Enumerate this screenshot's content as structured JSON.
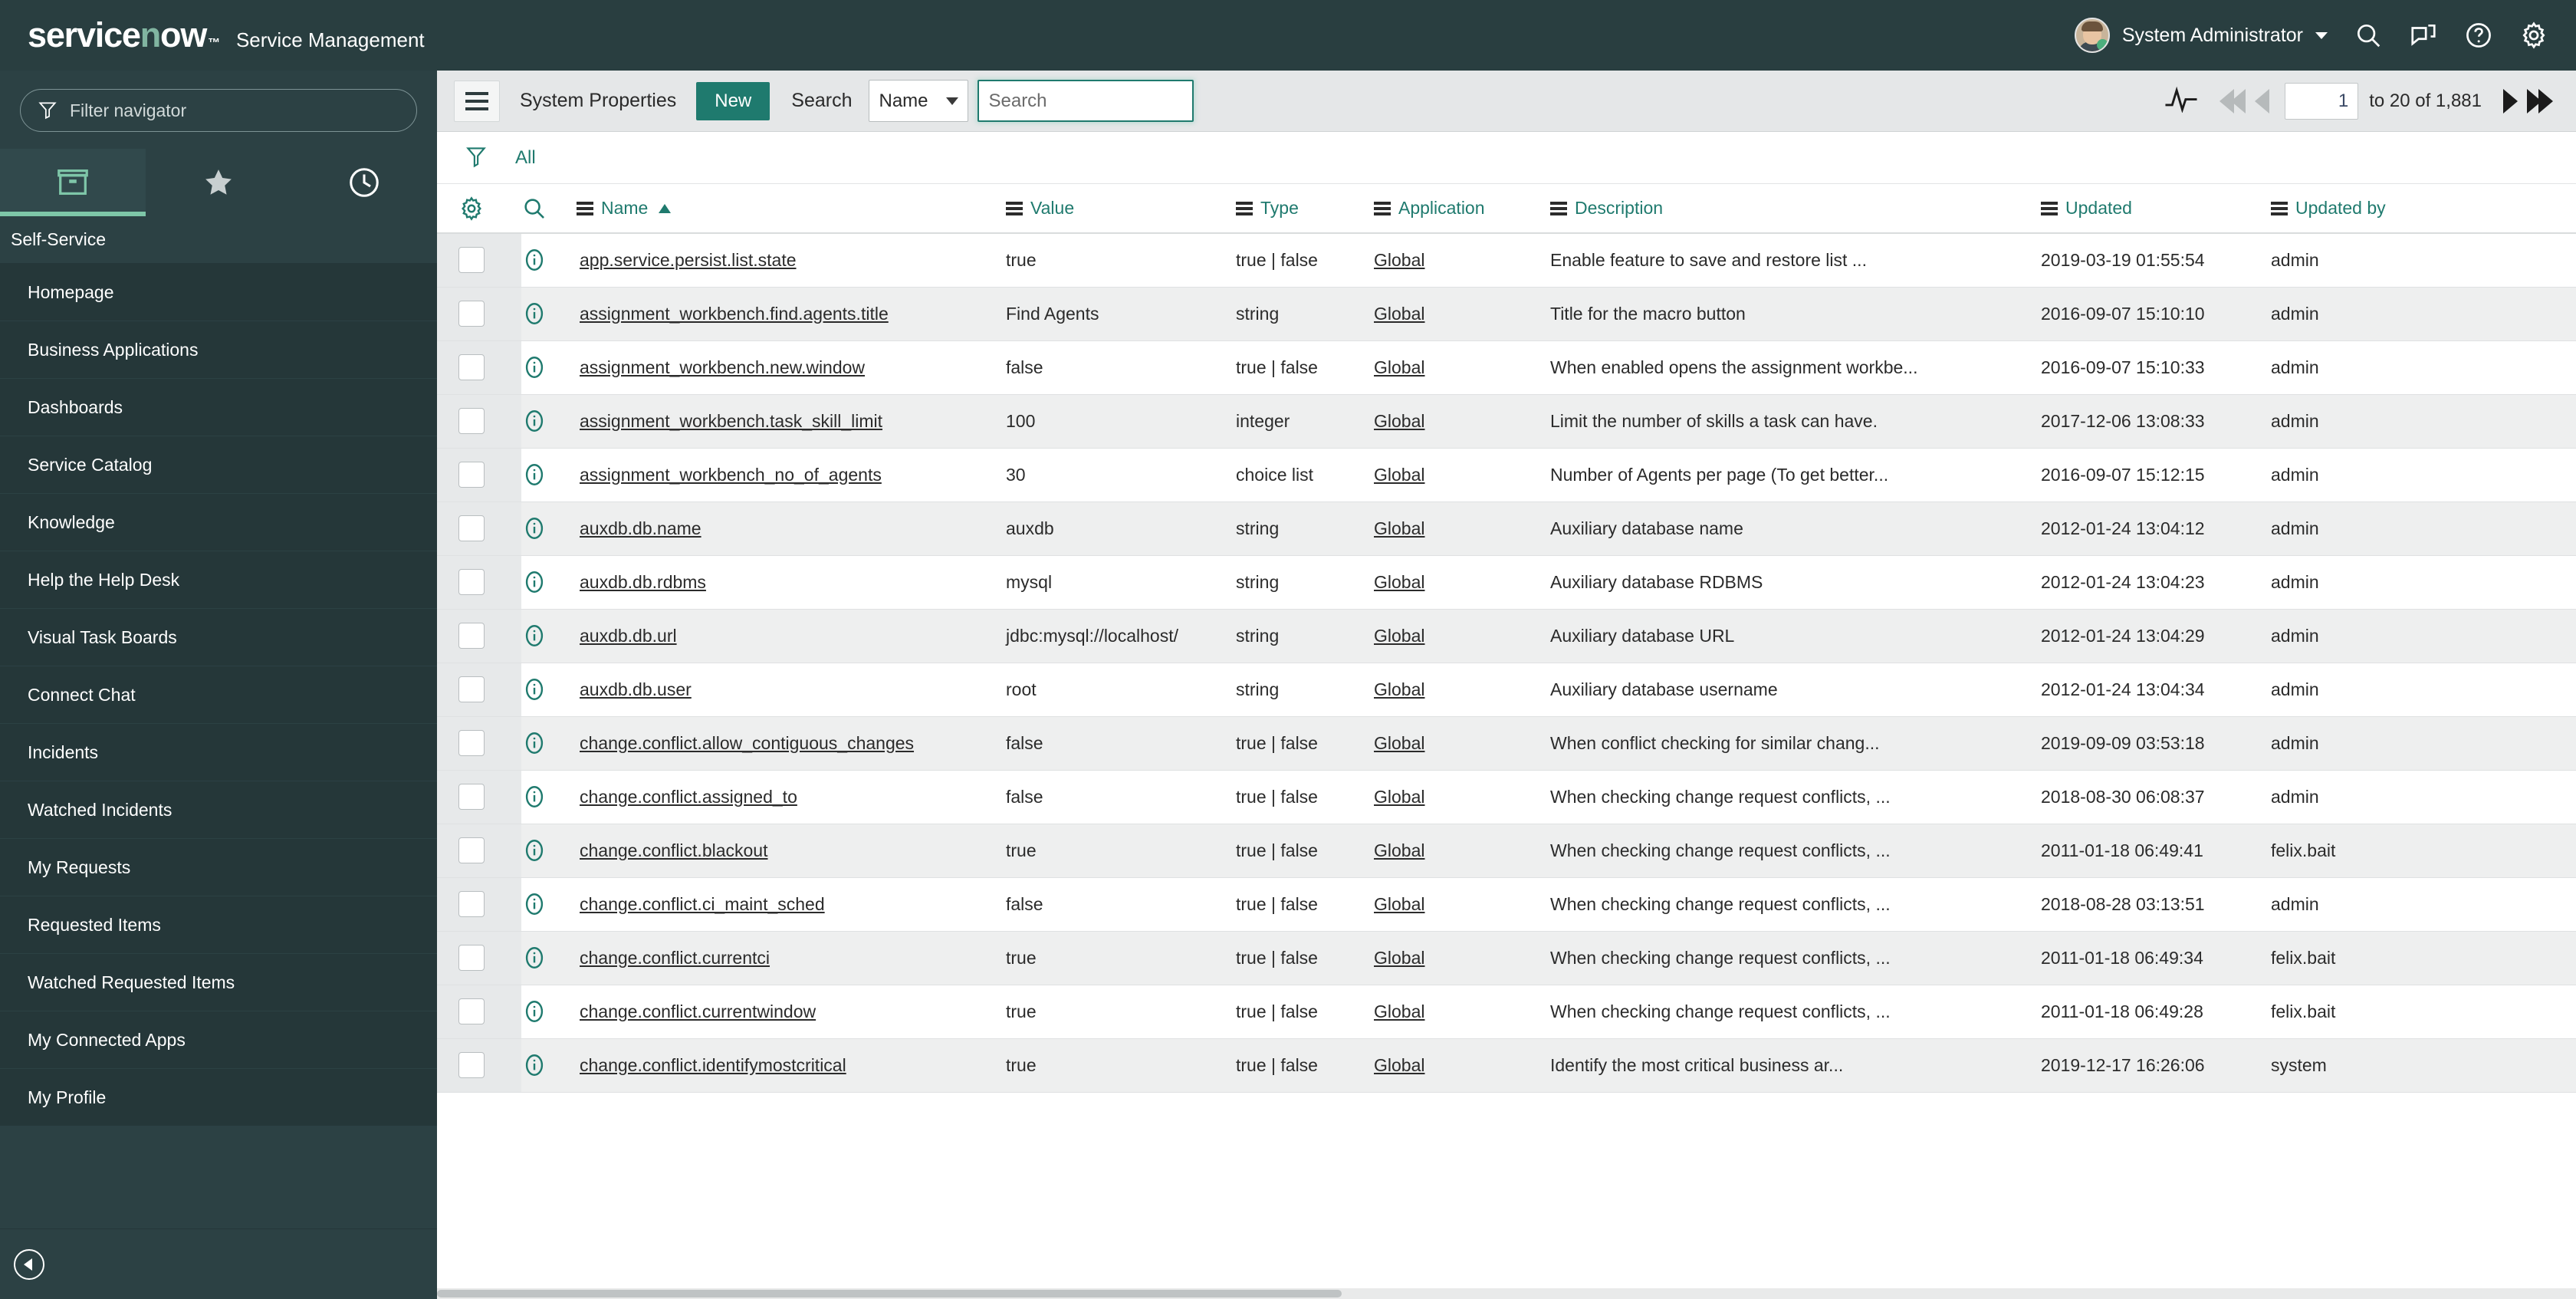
{
  "banner": {
    "logo_part1": "service",
    "logo_letter_o": "n",
    "logo_part3": "w",
    "logo_full": "servicenow",
    "product_name": "Service Management",
    "user_name": "System Administrator",
    "icons": [
      "search-icon",
      "conversations-icon",
      "help-icon",
      "gear-icon"
    ],
    "brand_color": "#293e40",
    "accent_color": "#81b5a1"
  },
  "sidebar": {
    "filter_placeholder": "Filter navigator",
    "filter_value": "",
    "tabs": [
      {
        "name": "all-applications-tab",
        "icon": "box-icon",
        "active": true
      },
      {
        "name": "favorites-tab",
        "icon": "star-icon",
        "active": false
      },
      {
        "name": "history-tab",
        "icon": "clock-icon",
        "active": false
      }
    ],
    "section_label": "Self-Service",
    "items": [
      {
        "label": "Homepage"
      },
      {
        "label": "Business Applications"
      },
      {
        "label": "Dashboards"
      },
      {
        "label": "Service Catalog"
      },
      {
        "label": "Knowledge"
      },
      {
        "label": "Help the Help Desk"
      },
      {
        "label": "Visual Task Boards"
      },
      {
        "label": "Connect Chat"
      },
      {
        "label": "Incidents"
      },
      {
        "label": "Watched Incidents"
      },
      {
        "label": "My Requests"
      },
      {
        "label": "Requested Items"
      },
      {
        "label": "Watched Requested Items"
      },
      {
        "label": "My Connected Apps"
      },
      {
        "label": "My Profile"
      }
    ],
    "collapse_icon": "collapse-left-icon"
  },
  "toolbar": {
    "menu_icon": "hamburger-menu-icon",
    "title": "System Properties",
    "new_label": "New",
    "search_label": "Search",
    "search_field_selected": "Name",
    "search_field_options": [
      "Name"
    ],
    "search_placeholder": "Search",
    "search_value": "",
    "pulse_icon": "activity-pulse-icon",
    "pagination": {
      "first_icon": "first-page-icon",
      "prev_icon": "previous-page-icon",
      "page_value": "1",
      "range_text": "to 20 of 1,881",
      "next_icon": "next-page-icon",
      "last_icon": "last-page-icon"
    }
  },
  "filter_bar": {
    "funnel_icon": "filter-funnel-icon",
    "all_label": "All"
  },
  "table": {
    "personalize_icon": "gear-icon",
    "search_row_icon": "magnifier-icon",
    "sort_column": "Name",
    "sort_direction": "asc",
    "columns": [
      {
        "key": "name",
        "label": "Name"
      },
      {
        "key": "value",
        "label": "Value"
      },
      {
        "key": "type",
        "label": "Type"
      },
      {
        "key": "application",
        "label": "Application"
      },
      {
        "key": "description",
        "label": "Description"
      },
      {
        "key": "updated",
        "label": "Updated"
      },
      {
        "key": "updated_by",
        "label": "Updated by"
      }
    ],
    "rows": [
      {
        "name": "app.service.persist.list.state",
        "value": "true",
        "type": "true | false",
        "application": "Global",
        "description": "Enable feature to save and restore list ...",
        "updated": "2019-03-19 01:55:54",
        "updated_by": "admin"
      },
      {
        "name": "assignment_workbench.find.agents.title",
        "value": "Find Agents",
        "type": "string",
        "application": "Global",
        "description": "Title for the macro button",
        "updated": "2016-09-07 15:10:10",
        "updated_by": "admin"
      },
      {
        "name": "assignment_workbench.new.window",
        "value": "false",
        "type": "true | false",
        "application": "Global",
        "description": "When enabled opens the assignment workbe...",
        "updated": "2016-09-07 15:10:33",
        "updated_by": "admin"
      },
      {
        "name": "assignment_workbench.task_skill_limit",
        "value": "100",
        "type": "integer",
        "application": "Global",
        "description": "Limit the number of skills a task can have.",
        "updated": "2017-12-06 13:08:33",
        "updated_by": "admin"
      },
      {
        "name": "assignment_workbench_no_of_agents",
        "value": "30",
        "type": "choice list",
        "application": "Global",
        "description": "Number of Agents per page (To get better...",
        "updated": "2016-09-07 15:12:15",
        "updated_by": "admin"
      },
      {
        "name": "auxdb.db.name",
        "value": "auxdb",
        "type": "string",
        "application": "Global",
        "description": "Auxiliary database name",
        "updated": "2012-01-24 13:04:12",
        "updated_by": "admin"
      },
      {
        "name": "auxdb.db.rdbms",
        "value": "mysql",
        "type": "string",
        "application": "Global",
        "description": "Auxiliary database RDBMS",
        "updated": "2012-01-24 13:04:23",
        "updated_by": "admin"
      },
      {
        "name": "auxdb.db.url",
        "value": "jdbc:mysql://localhost/",
        "type": "string",
        "application": "Global",
        "description": "Auxiliary database URL",
        "updated": "2012-01-24 13:04:29",
        "updated_by": "admin"
      },
      {
        "name": "auxdb.db.user",
        "value": "root",
        "type": "string",
        "application": "Global",
        "description": "Auxiliary database username",
        "updated": "2012-01-24 13:04:34",
        "updated_by": "admin"
      },
      {
        "name": "change.conflict.allow_contiguous_changes",
        "value": "false",
        "type": "true | false",
        "application": "Global",
        "description": "When conflict checking for similar chang...",
        "updated": "2019-09-09 03:53:18",
        "updated_by": "admin"
      },
      {
        "name": "change.conflict.assigned_to",
        "value": "false",
        "type": "true | false",
        "application": "Global",
        "description": "When checking change request conflicts, ...",
        "updated": "2018-08-30 06:08:37",
        "updated_by": "admin"
      },
      {
        "name": "change.conflict.blackout",
        "value": "true",
        "type": "true | false",
        "application": "Global",
        "description": "When checking change request conflicts, ...",
        "updated": "2011-01-18 06:49:41",
        "updated_by": "felix.bait"
      },
      {
        "name": "change.conflict.ci_maint_sched",
        "value": "false",
        "type": "true | false",
        "application": "Global",
        "description": "When checking change request conflicts, ...",
        "updated": "2018-08-28 03:13:51",
        "updated_by": "admin"
      },
      {
        "name": "change.conflict.currentci",
        "value": "true",
        "type": "true | false",
        "application": "Global",
        "description": "When checking change request conflicts, ...",
        "updated": "2011-01-18 06:49:34",
        "updated_by": "felix.bait"
      },
      {
        "name": "change.conflict.currentwindow",
        "value": "true",
        "type": "true | false",
        "application": "Global",
        "description": "When checking change request conflicts, ...",
        "updated": "2011-01-18 06:49:28",
        "updated_by": "felix.bait"
      },
      {
        "name": "change.conflict.identifymostcritical",
        "value": "true",
        "type": "true | false",
        "application": "Global",
        "description": "Identify the most critical business ar...",
        "updated": "2019-12-17 16:26:06",
        "updated_by": "system"
      }
    ]
  }
}
